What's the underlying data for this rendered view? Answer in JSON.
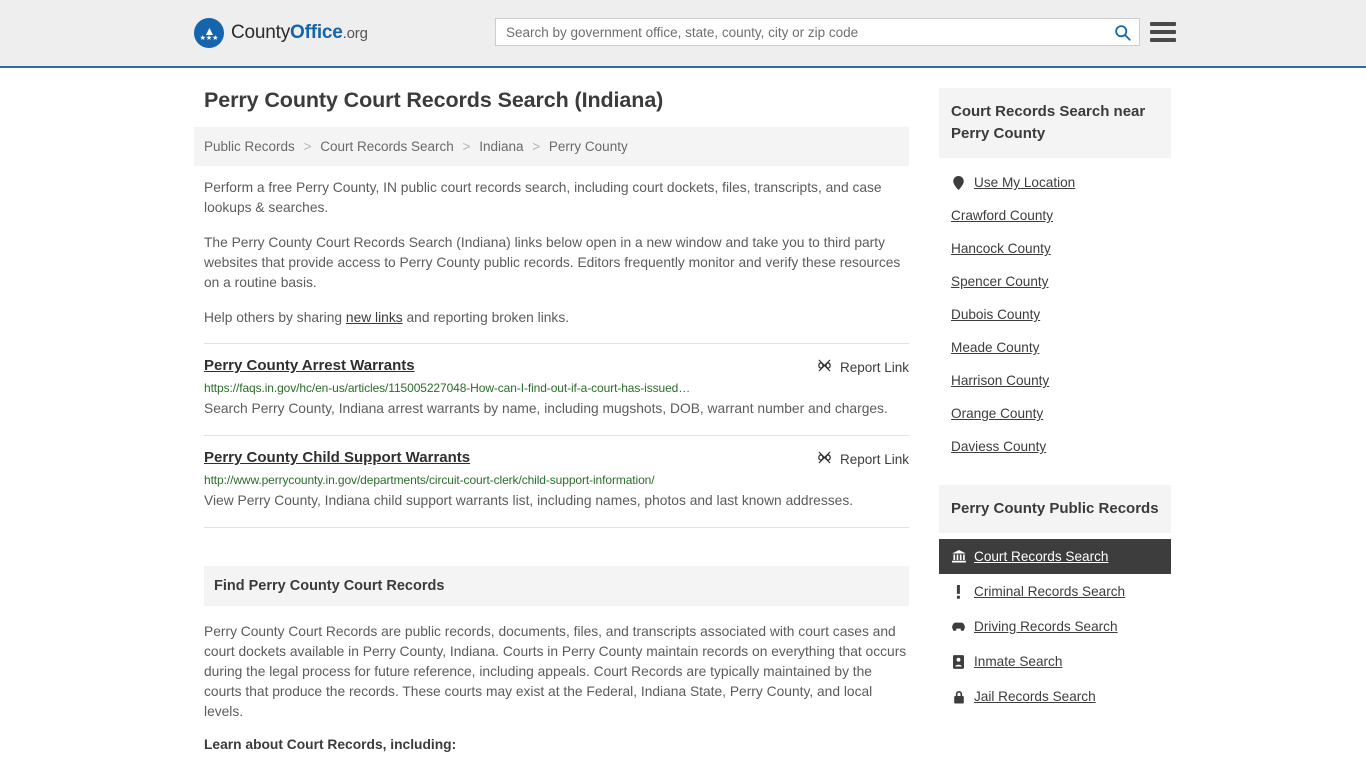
{
  "header": {
    "brand": {
      "part1": "County",
      "part2": "Office",
      "part3": ".org",
      "logo_icon": "eagle-stars-emblem"
    },
    "search": {
      "placeholder": "Search by government office, state, county, city or zip code",
      "value": "",
      "icon": "search-icon"
    },
    "menu": {
      "icon": "hamburger-menu-icon"
    }
  },
  "main": {
    "title": "Perry County Court Records Search (Indiana)",
    "breadcrumb": [
      {
        "label": "Public Records"
      },
      {
        "label": "Court Records Search"
      },
      {
        "label": "Indiana"
      },
      {
        "label": "Perry County"
      }
    ],
    "breadcrumb_separator": ">",
    "intro_paragraphs": [
      "Perform a free Perry County, IN public court records search, including court dockets, files, transcripts, and case lookups & searches.",
      "The Perry County Court Records Search (Indiana) links below open in a new window and take you to third party websites that provide access to Perry County public records. Editors frequently monitor and verify these resources on a routine basis."
    ],
    "help_line": {
      "before": "Help others by sharing ",
      "link": "new links",
      "after": " and reporting broken links."
    },
    "report_link_label": "Report Link",
    "report_link_icon": "broken-link-icon",
    "results": [
      {
        "title": "Perry County Arrest Warrants",
        "url": "https://faqs.in.gov/hc/en-us/articles/115005227048-How-can-I-find-out-if-a-court-has-issued…",
        "description": "Search Perry County, Indiana arrest warrants by name, including mugshots, DOB, warrant number and charges."
      },
      {
        "title": "Perry County Child Support Warrants",
        "url": "http://www.perrycounty.in.gov/departments/circuit-court-clerk/child-support-information/",
        "description": "View Perry County, Indiana child support warrants list, including names, photos and last known addresses."
      }
    ],
    "find_section": {
      "heading": "Find Perry County Court Records",
      "paragraph": "Perry County Court Records are public records, documents, files, and transcripts associated with court cases and court dockets available in Perry County, Indiana. Courts in Perry County maintain records on everything that occurs during the legal process for future reference, including appeals. Court Records are typically maintained by the courts that produce the records. These courts may exist at the Federal, Indiana State, Perry County, and local levels.",
      "subheading": "Learn about Court Records, including:"
    }
  },
  "sidebar": {
    "near_box": {
      "title": "Court Records Search near Perry County",
      "items": [
        {
          "label": "Use My Location",
          "icon": "map-pin-icon"
        },
        {
          "label": "Crawford County",
          "icon": ""
        },
        {
          "label": "Hancock County",
          "icon": ""
        },
        {
          "label": "Spencer County",
          "icon": ""
        },
        {
          "label": "Dubois County",
          "icon": ""
        },
        {
          "label": "Meade County",
          "icon": ""
        },
        {
          "label": "Harrison County",
          "icon": ""
        },
        {
          "label": "Orange County",
          "icon": ""
        },
        {
          "label": "Daviess County",
          "icon": ""
        }
      ]
    },
    "public_records_box": {
      "title": "Perry County Public Records",
      "items": [
        {
          "label": "Court Records Search",
          "icon": "courthouse-icon",
          "active": true
        },
        {
          "label": "Criminal Records Search",
          "icon": "exclamation-icon",
          "active": false
        },
        {
          "label": "Driving Records Search",
          "icon": "car-icon",
          "active": false
        },
        {
          "label": "Inmate Search",
          "icon": "id-badge-icon",
          "active": false
        },
        {
          "label": "Jail Records Search",
          "icon": "lock-icon",
          "active": false
        }
      ]
    }
  },
  "colors": {
    "header_bg": "#eeeeee",
    "header_border": "#2a6ca8",
    "brand_blue": "#1565ad",
    "url_green": "#2b6d2b",
    "panel_gray": "#f4f4f4",
    "active_dark": "#3d3d3d",
    "body_text": "#5c5c5c"
  }
}
